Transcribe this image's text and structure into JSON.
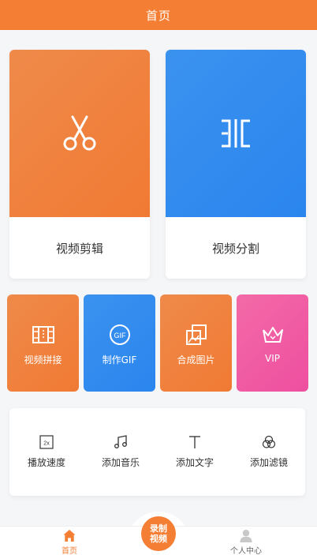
{
  "header": {
    "title": "首页"
  },
  "main_cards": [
    {
      "label": "视频剪辑",
      "icon": "scissors-icon"
    },
    {
      "label": "视频分割",
      "icon": "split-icon"
    }
  ],
  "feature_cards": [
    {
      "label": "视频拼接",
      "icon": "film-splice-icon"
    },
    {
      "label": "制作GIF",
      "icon": "gif-icon"
    },
    {
      "label": "合成图片",
      "icon": "images-icon"
    },
    {
      "label": "VIP",
      "icon": "crown-icon"
    }
  ],
  "tools": [
    {
      "label": "播放速度",
      "icon": "speed-icon",
      "badge": "2x"
    },
    {
      "label": "添加音乐",
      "icon": "music-icon"
    },
    {
      "label": "添加文字",
      "icon": "text-icon"
    },
    {
      "label": "添加滤镜",
      "icon": "filter-icon"
    }
  ],
  "tabbar": {
    "home": "首页",
    "record_line1": "录制",
    "record_line2": "视频",
    "profile": "个人中心"
  },
  "colors": {
    "primary": "#f47e33",
    "blue": "#2a85ee",
    "pink": "#ee4fa0"
  }
}
